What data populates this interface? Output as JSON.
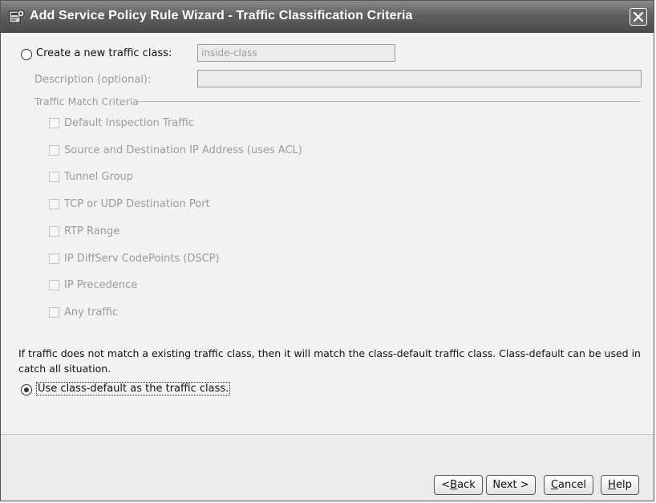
{
  "window": {
    "title": "Add Service Policy Rule Wizard - Traffic Classification Criteria",
    "title_icon": "asdm-app-icon",
    "close_icon": "close-icon"
  },
  "create_new": {
    "label": "Create a new traffic class:",
    "selected": false,
    "value": "inside-class"
  },
  "description": {
    "label": "Description (optional):",
    "value": ""
  },
  "match_criteria": {
    "group_label": "Traffic Match Criteria",
    "items": [
      {
        "label": "Default Inspection Traffic",
        "checked": false
      },
      {
        "label": "Source and Destination IP Address (uses ACL)",
        "checked": false
      },
      {
        "label": "Tunnel Group",
        "checked": false
      },
      {
        "label": "TCP or UDP Destination Port",
        "checked": false
      },
      {
        "label": "RTP Range",
        "checked": false
      },
      {
        "label": "IP DiffServ CodePoints (DSCP)",
        "checked": false
      },
      {
        "label": "IP Precedence",
        "checked": false
      },
      {
        "label": "Any traffic",
        "checked": false
      }
    ]
  },
  "info_text": "If traffic does not match a existing traffic class, then it will match the class-default traffic class. Class-default can be used in catch all situation.",
  "use_default": {
    "label": "Use class-default as the traffic class.",
    "selected": true
  },
  "buttons": {
    "back": {
      "mnemonic": "B",
      "rest": "ack",
      "prefix": "<"
    },
    "next": {
      "label": "Next >"
    },
    "cancel": {
      "mnemonic": "C",
      "rest": "ancel"
    },
    "help": {
      "mnemonic": "H",
      "rest": "elp"
    }
  }
}
